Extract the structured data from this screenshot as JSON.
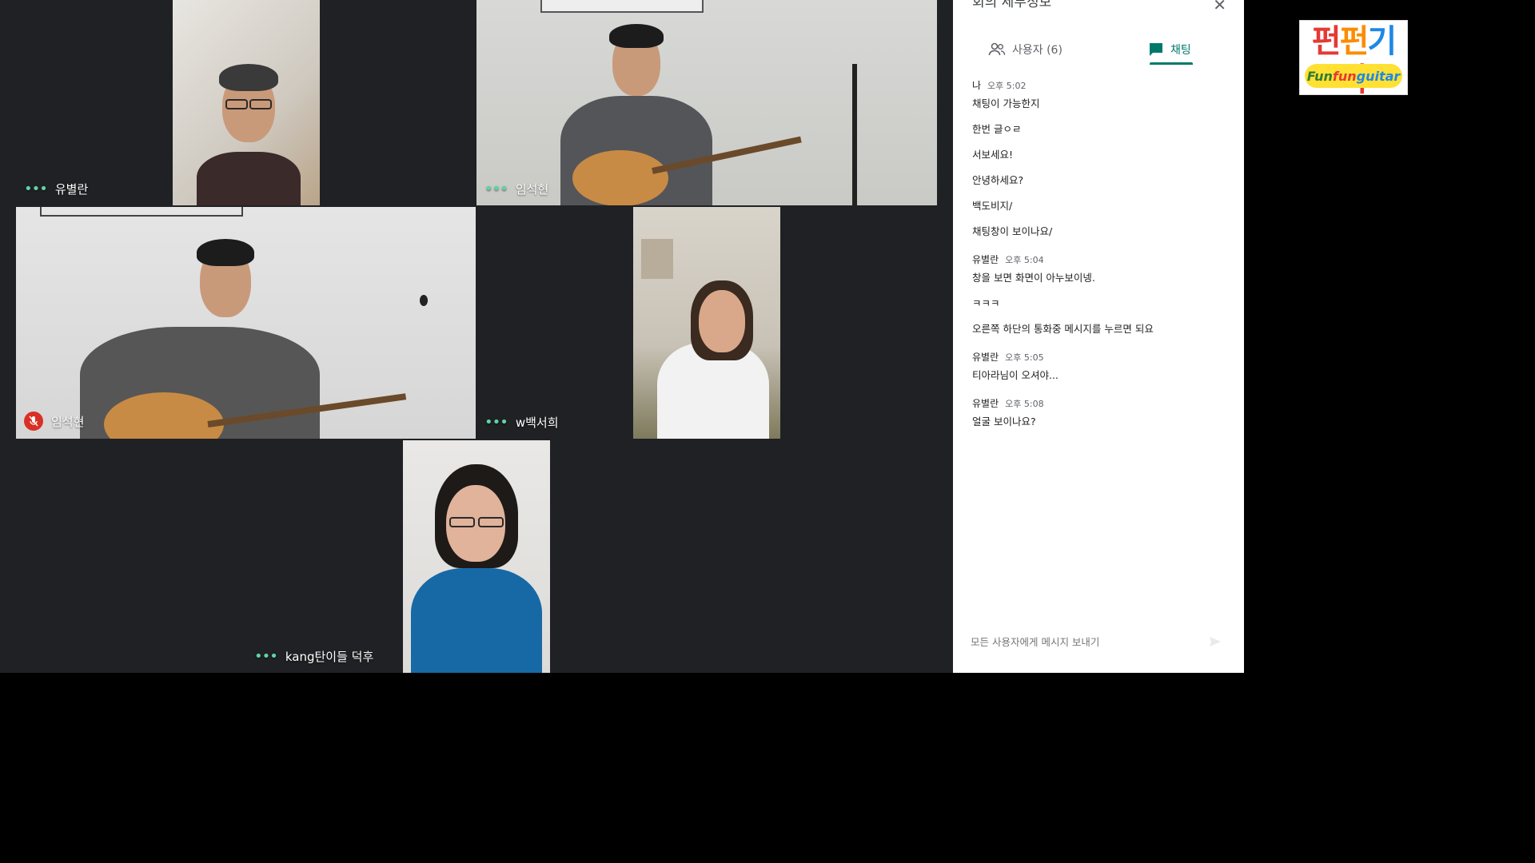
{
  "participants": [
    {
      "name": "유별란",
      "status": "dots"
    },
    {
      "name": "임석현",
      "status": "dots"
    },
    {
      "name": "임석현",
      "status": "muted"
    },
    {
      "name": "w백서희",
      "status": "dots"
    },
    {
      "name": "kang탄이들 덕후",
      "status": "dots"
    }
  ],
  "side_panel": {
    "title": "회의 세부정보",
    "tabs": {
      "users_label": "사용자 (6)",
      "chat_label": "채팅"
    },
    "chat": [
      {
        "sender": "나",
        "time": "오후 5:02",
        "lines": [
          "채팅이 가능한지",
          "한번 글ㅇㄹ",
          "서보세요!",
          "안녕하세요?",
          "백도비지/",
          "채팅창이 보이나요/"
        ]
      },
      {
        "sender": "유별란",
        "time": "오후 5:04",
        "lines": [
          "창을 보면 화면이 아누보이넹.",
          "ㅋㅋㅋ",
          "오른쪽 하단의 통화중 메시지를 누르면 되요"
        ]
      },
      {
        "sender": "유별란",
        "time": "오후 5:05",
        "lines": [
          "티아라님이 오셔야..."
        ]
      },
      {
        "sender": "유별란",
        "time": "오후 5:08",
        "lines": [
          "얼굴 보이나요?"
        ]
      }
    ],
    "input_placeholder": "모든 사용자에게 메시지 보내기"
  },
  "logo": {
    "korean": [
      "펀",
      "펀",
      "기",
      "타"
    ],
    "english": [
      "Fun ",
      "fun ",
      "guitar"
    ],
    "colors": [
      "#e53935",
      "#fb8c00",
      "#1e88e5",
      "#e53935"
    ]
  },
  "colors": {
    "accent": "#00796b",
    "stage_bg": "#202124",
    "muted_red": "#d93025",
    "speaking_dots": "#5fd3a5"
  }
}
